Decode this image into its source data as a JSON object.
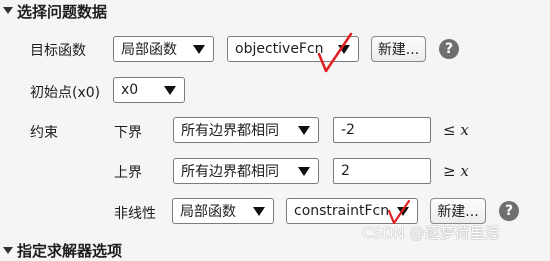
{
  "section": {
    "title": "选择问题数据"
  },
  "objective": {
    "label": "目标函数",
    "type_value": "局部函数",
    "fcn_value": "objectiveFcn",
    "new_button": "新建...",
    "help_glyph": "?"
  },
  "initial_point": {
    "label": "初始点(x0)",
    "value": "x0"
  },
  "constraints": {
    "label": "约束",
    "lower": {
      "label": "下界",
      "mode_value": "所有边界都相同",
      "value": "-2",
      "relation": "≤",
      "var": "x"
    },
    "upper": {
      "label": "上界",
      "mode_value": "所有边界都相同",
      "value": "2",
      "relation": "≥",
      "var": "x"
    },
    "nonlinear": {
      "label": "非线性",
      "type_value": "局部函数",
      "fcn_value": "constraintFcn",
      "new_button": "新建...",
      "help_glyph": "?"
    }
  },
  "next_section": {
    "title": "指定求解器选项"
  },
  "watermark": {
    "text": "CSDN @逐梦荷里活"
  },
  "colors": {
    "annotation_red": "#e02020",
    "help_gray": "#6f6f6f",
    "background": "#f5f5f5"
  },
  "icons": [
    "section-collapse-icon",
    "dropdown-arrow-icon",
    "help-icon",
    "red-checkmark-annotation"
  ]
}
